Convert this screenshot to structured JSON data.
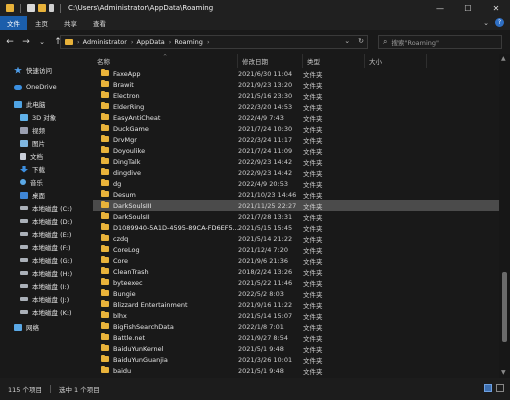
{
  "window": {
    "title": "C:\\Users\\Administrator\\AppData\\Roaming",
    "min_label": "—",
    "max_label": "☐",
    "close_label": "✕"
  },
  "ribbon": {
    "tabs": [
      "文件",
      "主页",
      "共享",
      "查看"
    ],
    "expand_label": "⌄",
    "help_label": "?"
  },
  "nav": {
    "back": "←",
    "forward": "→",
    "recent": "⌄",
    "up": "↑",
    "crumbs": [
      "Administrator",
      "AppData",
      "Roaming"
    ],
    "crumb_sep": "›",
    "dropdown": "⌄",
    "refresh": "↻",
    "search_placeholder": "搜索\"Roaming\"",
    "search_icon": "⌕"
  },
  "sidebar": {
    "items": [
      {
        "label": "快速访问",
        "icon": "star-icon",
        "color": "#4f9de8"
      },
      {
        "label": "OneDrive",
        "icon": "cloud-icon",
        "color": "#3b8fe0"
      },
      {
        "label": "此电脑",
        "icon": "computer-icon",
        "color": "#4fa3e3"
      },
      {
        "label": "3D 对象",
        "icon": "cube-icon",
        "color": "#5fb0e8"
      },
      {
        "label": "视频",
        "icon": "video-icon",
        "color": "#9a9fb0"
      },
      {
        "label": "图片",
        "icon": "picture-icon",
        "color": "#7fb6e0"
      },
      {
        "label": "文档",
        "icon": "document-icon",
        "color": "#c9ced8"
      },
      {
        "label": "下载",
        "icon": "download-icon",
        "color": "#3d8fe0"
      },
      {
        "label": "音乐",
        "icon": "music-icon",
        "color": "#5aa8e6"
      },
      {
        "label": "桌面",
        "icon": "desktop-icon",
        "color": "#3f86d6"
      },
      {
        "label": "本地磁盘 (C:)",
        "icon": "drive-icon",
        "color": "#aab0b8"
      },
      {
        "label": "本地磁盘 (D:)",
        "icon": "drive-icon",
        "color": "#aab0b8"
      },
      {
        "label": "本地磁盘 (E:)",
        "icon": "drive-icon",
        "color": "#aab0b8"
      },
      {
        "label": "本地磁盘 (F:)",
        "icon": "drive-icon",
        "color": "#aab0b8"
      },
      {
        "label": "本地磁盘 (G:)",
        "icon": "drive-icon",
        "color": "#aab0b8"
      },
      {
        "label": "本地磁盘 (H:)",
        "icon": "drive-icon",
        "color": "#aab0b8"
      },
      {
        "label": "本地磁盘 (I:)",
        "icon": "drive-icon",
        "color": "#aab0b8"
      },
      {
        "label": "本地磁盘 (J:)",
        "icon": "drive-icon",
        "color": "#aab0b8"
      },
      {
        "label": "本地磁盘 (K:)",
        "icon": "drive-icon",
        "color": "#aab0b8"
      },
      {
        "label": "网络",
        "icon": "network-icon",
        "color": "#5aa8e6"
      }
    ]
  },
  "columns": {
    "name": "名称",
    "date": "修改日期",
    "type": "类型",
    "size": "大小",
    "sort_indicator": "^"
  },
  "files": [
    {
      "name": "FaxeApp",
      "date": "2021/6/30 11:04",
      "type": "文件夹"
    },
    {
      "name": "Brawit",
      "date": "2021/9/23 13:20",
      "type": "文件夹"
    },
    {
      "name": "Electron",
      "date": "2021/5/16 23:30",
      "type": "文件夹"
    },
    {
      "name": "ElderRing",
      "date": "2022/3/20 14:53",
      "type": "文件夹"
    },
    {
      "name": "EasyAntiCheat",
      "date": "2022/4/9 7:43",
      "type": "文件夹"
    },
    {
      "name": "DuckGame",
      "date": "2021/7/24 10:30",
      "type": "文件夹"
    },
    {
      "name": "DrvMgr",
      "date": "2022/3/24 11:17",
      "type": "文件夹"
    },
    {
      "name": "Doyoulike",
      "date": "2021/7/24 11:09",
      "type": "文件夹"
    },
    {
      "name": "DingTalk",
      "date": "2022/9/23 14:42",
      "type": "文件夹"
    },
    {
      "name": "dingdive",
      "date": "2022/9/23 14:42",
      "type": "文件夹"
    },
    {
      "name": "dg",
      "date": "2022/4/9 20:53",
      "type": "文件夹"
    },
    {
      "name": "Desum",
      "date": "2021/10/23 14:46",
      "type": "文件夹"
    },
    {
      "name": "DarkSoulsIII",
      "date": "2021/11/25 22:27",
      "type": "文件夹"
    },
    {
      "name": "DarkSoulsII",
      "date": "2021/7/28 13:31",
      "type": "文件夹"
    },
    {
      "name": "D1089940-5A1D-4595-89CA-FD6EF5...",
      "date": "2021/5/15 15:45",
      "type": "文件夹"
    },
    {
      "name": "czdq",
      "date": "2021/5/14 21:22",
      "type": "文件夹"
    },
    {
      "name": "CoreLog",
      "date": "2021/12/4 7:20",
      "type": "文件夹"
    },
    {
      "name": "Core",
      "date": "2021/9/6 21:36",
      "type": "文件夹"
    },
    {
      "name": "CleanTrash",
      "date": "2018/2/24 13:26",
      "type": "文件夹"
    },
    {
      "name": "byteexec",
      "date": "2021/5/22 11:46",
      "type": "文件夹"
    },
    {
      "name": "Bungie",
      "date": "2022/5/2 8:03",
      "type": "文件夹"
    },
    {
      "name": "Blizzard Entertainment",
      "date": "2021/9/16 11:22",
      "type": "文件夹"
    },
    {
      "name": "blhx",
      "date": "2021/5/14 15:07",
      "type": "文件夹"
    },
    {
      "name": "BigFishSearchData",
      "date": "2022/1/8 7:01",
      "type": "文件夹"
    },
    {
      "name": "Battle.net",
      "date": "2021/9/27 8:54",
      "type": "文件夹"
    },
    {
      "name": "BaiduYunKernel",
      "date": "2021/5/1 9:48",
      "type": "文件夹"
    },
    {
      "name": "BaiduYunGuanjia",
      "date": "2021/3/26 10:01",
      "type": "文件夹"
    },
    {
      "name": "baidu",
      "date": "2021/5/1 9:48",
      "type": "文件夹"
    }
  ],
  "selected_index": 12,
  "scroll_position": 0.7,
  "status": {
    "count": "115 个项目",
    "selected": "选中 1 个项目"
  },
  "colors": {
    "accent": "#1b5eab",
    "folder": "#e8b23a",
    "selection": "#4b4b4b",
    "background": "#191919"
  }
}
